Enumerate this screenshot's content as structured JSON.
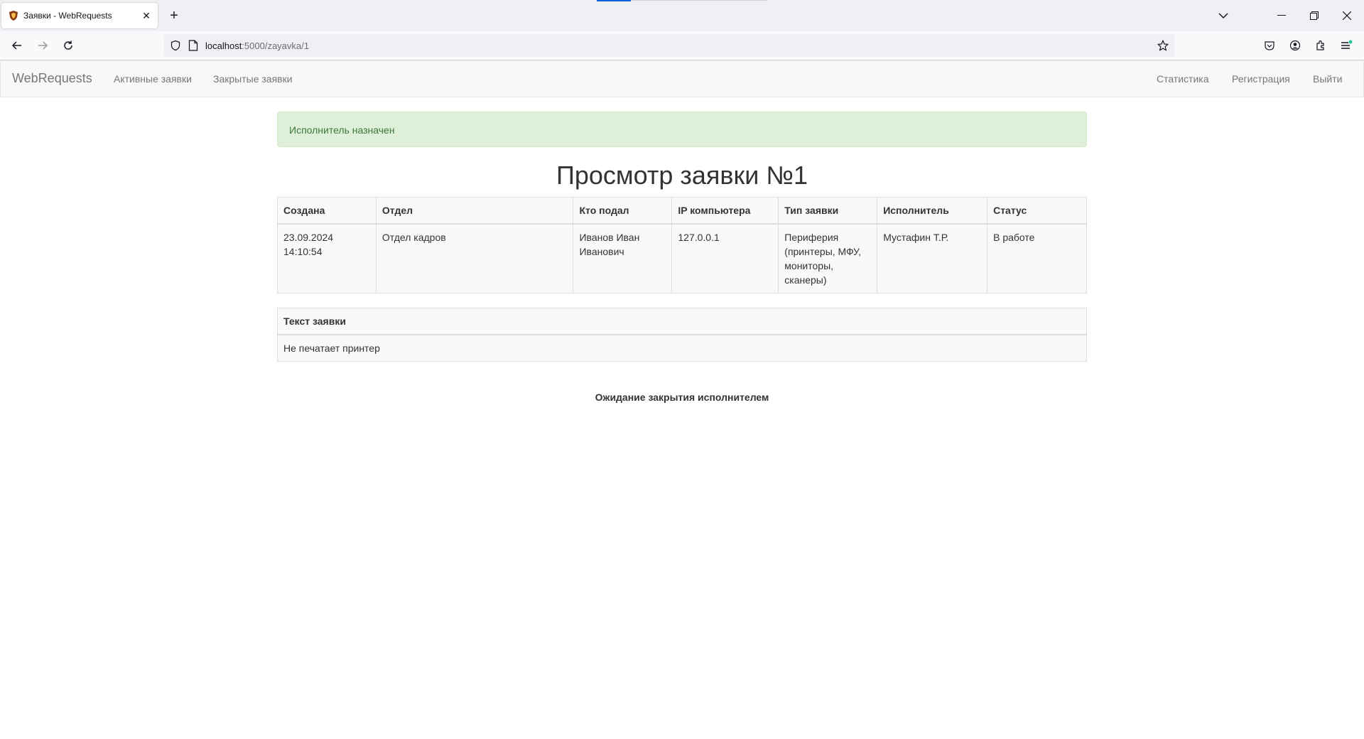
{
  "browser": {
    "tab_title": "Заявки - WebRequests",
    "url_host": "localhost",
    "url_path": ":5000/zayavka/1"
  },
  "navbar": {
    "brand": "WebRequests",
    "left_links": [
      "Активные заявки",
      "Закрытые заявки"
    ],
    "right_links": [
      "Статистика",
      "Регистрация",
      "Выйти"
    ]
  },
  "alert": {
    "text": "Исполнитель назначен"
  },
  "page_title": "Просмотр заявки №1",
  "request_table": {
    "headers": [
      "Создана",
      "Отдел",
      "Кто подал",
      "IP компьютера",
      "Тип заявки",
      "Исполнитель",
      "Статус"
    ],
    "row": {
      "created_date": "23.09.2024",
      "created_time": "14:10:54",
      "department": "Отдел кадров",
      "submitter": "Иванов Иван Иванович",
      "ip": "127.0.0.1",
      "type": "Периферия (принтеры, МФУ, мониторы, сканеры)",
      "executor": "Мустафин Т.Р.",
      "status": "В работе"
    }
  },
  "text_table": {
    "header": "Текст заявки",
    "text": "Не печатает принтер"
  },
  "footer_status": "Ожидание закрытия исполнителем",
  "colors": {
    "alert_bg": "#dff0d8",
    "alert_text": "#3c763d",
    "navbar_bg": "#f8f8f8"
  }
}
